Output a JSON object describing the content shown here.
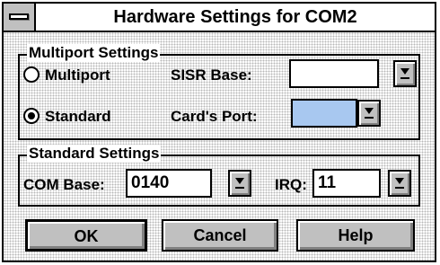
{
  "window": {
    "title": "Hardware Settings for COM2"
  },
  "multiport": {
    "label": "Multiport Settings",
    "multiport_radio": "Multiport",
    "standard_radio": "Standard",
    "selected": "Standard",
    "sisr_base_label": "SISR Base:",
    "sisr_base_value": "",
    "cards_port_label": "Card's Port:",
    "cards_port_value": ""
  },
  "standard": {
    "label": "Standard Settings",
    "com_base_label": "COM Base:",
    "com_base_value": "0140",
    "irq_label": "IRQ:",
    "irq_value": "11"
  },
  "buttons": {
    "ok": "OK",
    "cancel": "Cancel",
    "help": "Help"
  },
  "icons": {
    "system_menu": "system-menu-icon",
    "dropdown": "dropdown-arrow-icon"
  },
  "colors": {
    "highlight_field": "#a8c8f0",
    "button_face": "#c0c0c0"
  }
}
